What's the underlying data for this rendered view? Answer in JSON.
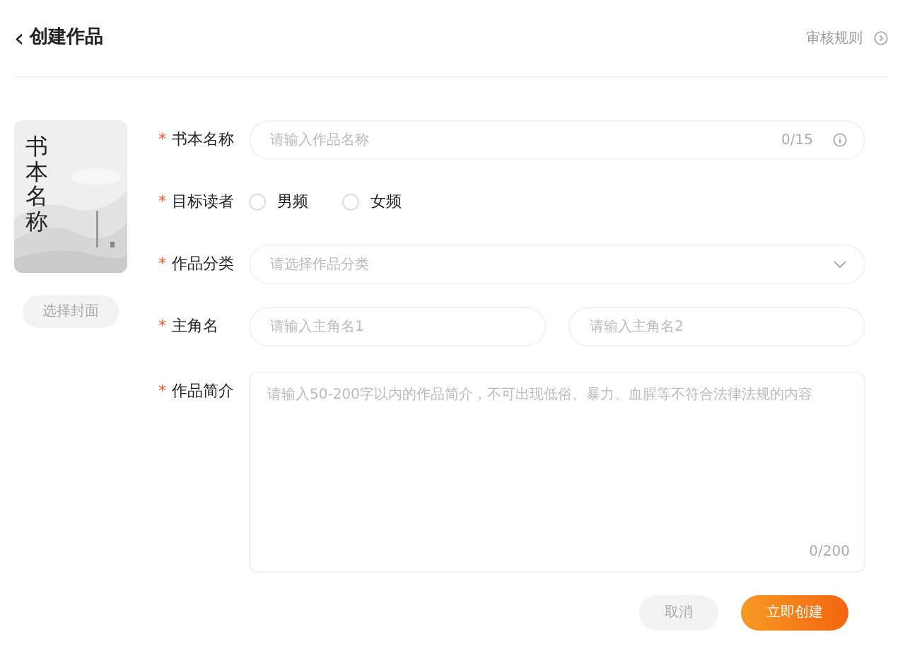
{
  "header": {
    "back_icon": "‹",
    "title": "创建作品",
    "rules_link": "审核规则"
  },
  "cover": {
    "title": "书本名称",
    "button": "选择封面"
  },
  "form": [
    {
      "kind": "text",
      "label": "书本名称",
      "required_mark": "*",
      "placeholder": "请输入作品名称",
      "counter": "0/15"
    },
    {
      "kind": "radio",
      "label": "目标读者",
      "required_mark": "*",
      "options": [
        {
          "label": "男频",
          "selected": false
        },
        {
          "label": "女频",
          "selected": false
        }
      ]
    },
    {
      "kind": "select",
      "label": "作品分类",
      "required_mark": "*",
      "placeholder": "请选择作品分类"
    },
    {
      "kind": "pair",
      "label": "主角名",
      "required_mark": "*",
      "placeholders": [
        "请输入主角名1",
        "请输入主角名2"
      ]
    },
    {
      "kind": "textarea",
      "label": "作品简介",
      "required_mark": "*",
      "placeholder": "请输入50-200字以内的作品简介，不可出现低俗、暴力、血腥等不符合法律法规的内容",
      "counter": "0/200"
    }
  ],
  "buttons": [
    {
      "label": "取消",
      "kind": "secondary"
    },
    {
      "label": "立即创建",
      "kind": "primary"
    }
  ]
}
